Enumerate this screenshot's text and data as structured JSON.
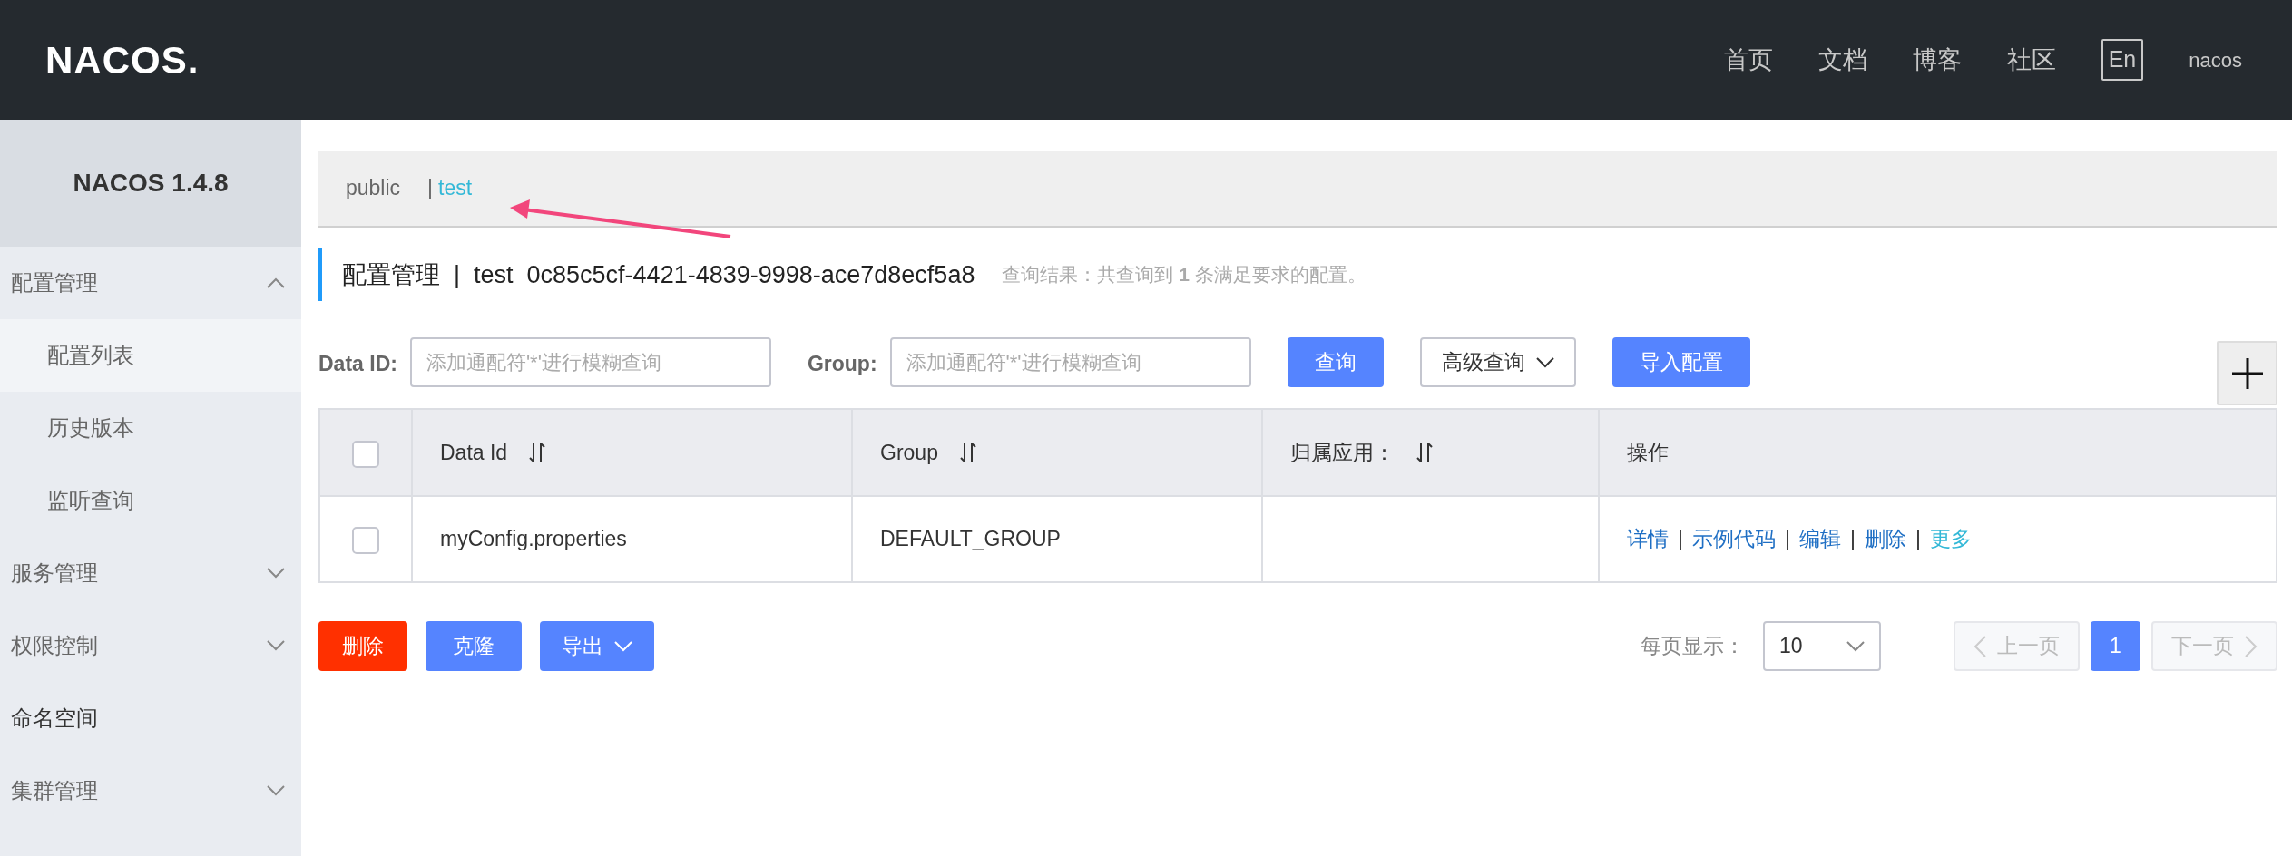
{
  "header": {
    "logo": "NACOS.",
    "nav": [
      {
        "label": "首页"
      },
      {
        "label": "文档"
      },
      {
        "label": "博客"
      },
      {
        "label": "社区"
      }
    ],
    "language": "En",
    "user": "nacos"
  },
  "sidebar": {
    "title": "NACOS 1.4.8",
    "items": [
      {
        "label": "配置管理",
        "kind": "group",
        "expanded": true,
        "children": [
          {
            "label": "配置列表",
            "selected": true
          },
          {
            "label": "历史版本",
            "selected": false
          },
          {
            "label": "监听查询",
            "selected": false
          }
        ]
      },
      {
        "label": "服务管理",
        "kind": "group",
        "expanded": false
      },
      {
        "label": "权限控制",
        "kind": "group",
        "expanded": false
      },
      {
        "label": "命名空间",
        "kind": "link"
      },
      {
        "label": "集群管理",
        "kind": "group",
        "expanded": false
      }
    ]
  },
  "namespaces": {
    "separator": "|",
    "items": [
      {
        "label": "public",
        "selected": false
      },
      {
        "label": "test",
        "selected": true
      }
    ]
  },
  "heading": {
    "title": "配置管理  |  test  0c85c5cf-4421-4839-9998-ace7d8ecf5a8",
    "result": "查询结果：共查询到 **1** 条满足要求的配置。"
  },
  "search": {
    "fields": [
      {
        "label": "Data ID:",
        "placeholder": "添加通配符'*'进行模糊查询"
      },
      {
        "label": "Group:",
        "placeholder": "添加通配符'*'进行模糊查询"
      }
    ],
    "buttons": [
      {
        "label": "查询",
        "kind": "primary"
      },
      {
        "label": "高级查询",
        "kind": "dropdown"
      },
      {
        "label": "导入配置",
        "kind": "primary"
      }
    ]
  },
  "table": {
    "select_all": {
      "checked": false
    },
    "columns": [
      {
        "label": "Data Id",
        "sortable": true
      },
      {
        "label": "Group",
        "sortable": true
      },
      {
        "label": "归属应用：",
        "sortable": true
      },
      {
        "label": "操作",
        "sortable": false
      }
    ],
    "action_separator": "|",
    "rows": [
      {
        "checked": false,
        "data_id": "myConfig.properties",
        "group": "DEFAULT_GROUP",
        "actions": [
          {
            "label": "详情",
            "kind": "link"
          },
          {
            "label": "示例代码",
            "kind": "link"
          },
          {
            "label": "编辑",
            "kind": "link"
          },
          {
            "label": "删除",
            "kind": "link"
          },
          {
            "label": "更多",
            "kind": "menu"
          }
        ]
      }
    ]
  },
  "bulk_actions": [
    {
      "label": "删除",
      "kind": "danger"
    },
    {
      "label": "克隆",
      "kind": "primary"
    },
    {
      "label": "导出",
      "kind": "dropdown"
    }
  ],
  "pagination": {
    "page_size_label": "每页显示：",
    "page_size": "10",
    "prev": "上一页",
    "prev_disabled": true,
    "pages": [
      {
        "label": "1",
        "selected": true
      }
    ],
    "next": "下一页",
    "next_disabled": true
  }
}
